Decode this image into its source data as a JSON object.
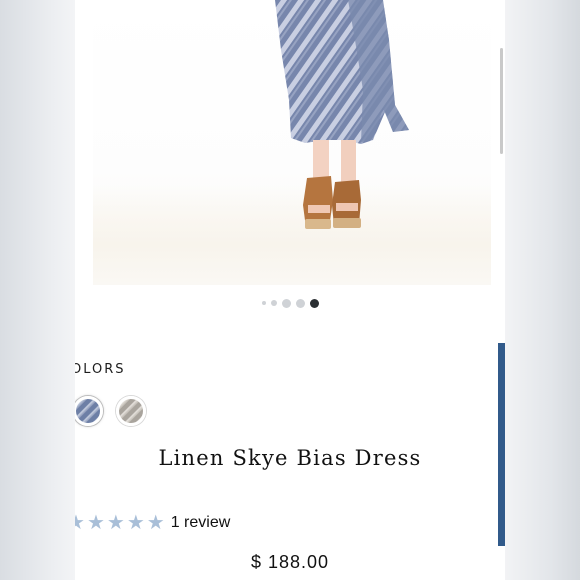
{
  "product": {
    "title": "Linen Skye Bias Dress",
    "price": "$ 188.00",
    "colors_label": "OLORS",
    "colors": [
      {
        "name": "blue-tie-dye-swatch",
        "selected": true,
        "color": "#6d7fa6"
      },
      {
        "name": "grey-tie-dye-swatch",
        "selected": false,
        "color": "#a9a49d"
      }
    ],
    "rating": {
      "stars": 5,
      "filled": 5,
      "star_glyph": "★",
      "star_color": "#a9bfd8",
      "review_text": "1 review"
    }
  },
  "gallery": {
    "total_images": 5,
    "active_index": 4
  },
  "colors": {
    "accent": "#315a8a",
    "background": "#ffffff"
  }
}
